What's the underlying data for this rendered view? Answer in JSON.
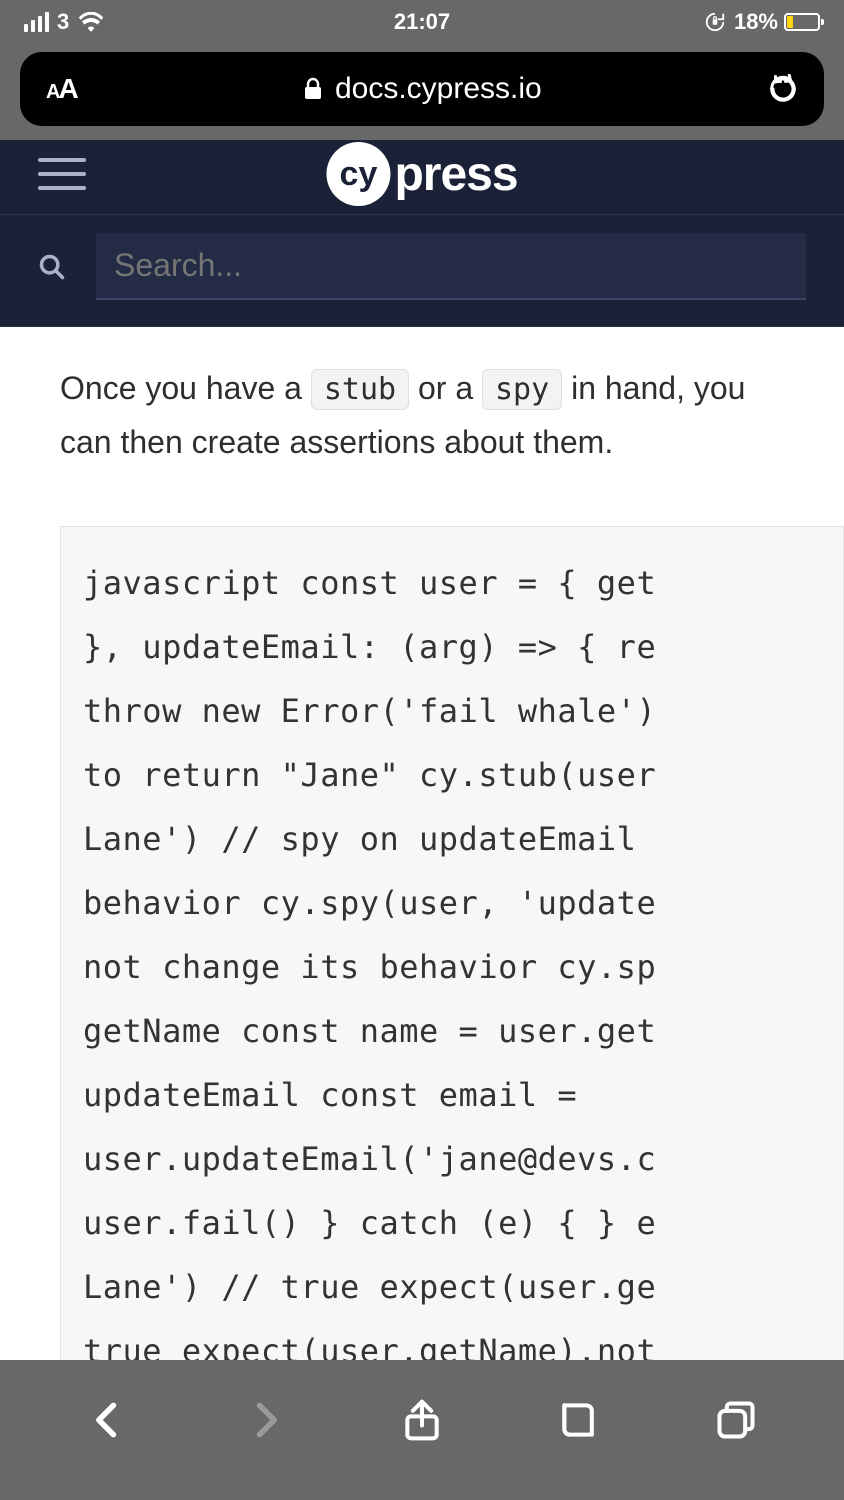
{
  "status": {
    "carrier": "3",
    "time": "21:07",
    "battery_pct": "18%"
  },
  "safari": {
    "aa_label": "AA",
    "url": "docs.cypress.io"
  },
  "nav": {
    "logo_badge": "cy",
    "logo_text": "press",
    "search_placeholder": "Search..."
  },
  "page": {
    "intro_pre": "Once you have a ",
    "chip_stub": "stub",
    "intro_mid": " or a ",
    "chip_spy": "spy",
    "intro_post": " in hand, you can then create assertions about them.",
    "code": "javascript const user = { get\n}, updateEmail: (arg) => { re\nthrow new Error('fail whale')\nto return \"Jane\" cy.stub(user\nLane') // spy on updateEmail \nbehavior cy.spy(user, 'update\nnot change its behavior cy.sp\ngetName const name = user.get\nupdateEmail const email = \nuser.updateEmail('jane@devs.c\nuser.fail() } catch (e) { } e\nLane') // true expect(user.ge\ntrue expect(user.getName).not\nexpect(user.getName).to.be.ca"
  }
}
